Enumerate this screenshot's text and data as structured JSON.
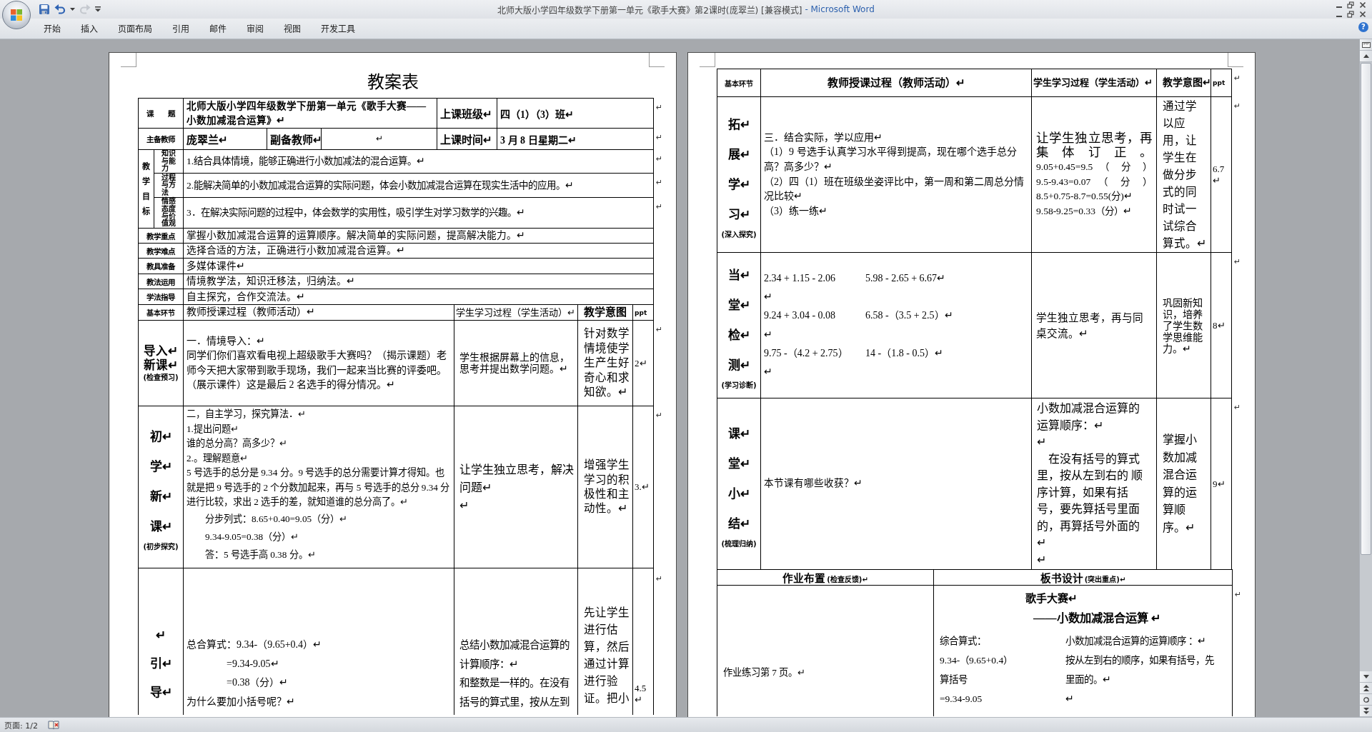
{
  "window": {
    "title": "北师大版小学四年级数学下册第一单元《歌手大赛》第2课时(庞翠兰) [兼容模式]",
    "app_name": "- Microsoft Word"
  },
  "quick_access": [
    {
      "kind": "save",
      "disabled": false
    },
    {
      "kind": "undo",
      "disabled": false
    },
    {
      "kind": "undo_menu",
      "disabled": false
    },
    {
      "kind": "redo",
      "disabled": true
    },
    {
      "kind": "customize",
      "disabled": false
    }
  ],
  "ribbon": {
    "tabs": [
      {
        "label": "开始",
        "selected": false
      },
      {
        "label": "插入",
        "selected": false
      },
      {
        "label": "页面布局",
        "selected": false
      },
      {
        "label": "引用",
        "selected": false
      },
      {
        "label": "邮件",
        "selected": false
      },
      {
        "label": "审阅",
        "selected": false
      },
      {
        "label": "视图",
        "selected": false
      },
      {
        "label": "开发工具",
        "selected": false
      }
    ],
    "help": "?"
  },
  "page_1": {
    "title": "教案表",
    "topic_row": {
      "label": "课　　题",
      "title": "北师大版小学四年级数学下册第一单元《歌手大赛——小数加减混合运算》↵",
      "class_label": "上课班级↵",
      "class_value": "四（1）（3）班↵",
      "end_mark": "↵"
    },
    "teacher_row": {
      "label": "主备教师",
      "lead_teacher": "庞翠兰↵",
      "assistant_label": "副备教师↵",
      "assistant": "↵",
      "time_label": "上课时间↵",
      "time": "3 月 8 日星期二↵",
      "end_mark": "↵"
    },
    "goals": {
      "label": "教学目标",
      "items": [
        {
          "label": "知识与能力",
          "text": "1.结合具体情境，能够正确进行小数加减法的混合运算。↵",
          "end_mark": "↵"
        },
        {
          "label": "过程与方法",
          "text": "2.能解决简单的小数加减混合运算的实际问题，体会小数加减混合运算在现实生活中的应用。↵",
          "end_mark": "↵"
        },
        {
          "label": "情感态度与价值观",
          "text": "3．在解决实际问题的过程中，体会数学的实用性，吸引学生对学习数学的兴趣。↵",
          "end_mark": "↵"
        }
      ]
    },
    "plan_rows": [
      {
        "label": "教学重点",
        "text": "掌握小数加减混合运算的运算顺序。解决简单的实际问题，提高解决能力。↵"
      },
      {
        "label": "教学难点",
        "text": "选择合适的方法，正确进行小数加减混合运算。↵"
      },
      {
        "label": "教具准备",
        "text": "多媒体课件↵"
      },
      {
        "label": "教法运用",
        "text": "情境教学法，知识迁移法，归纳法。↵"
      },
      {
        "label": "学法指导",
        "text": "自主探究，合作交流法。↵"
      }
    ],
    "lesson": {
      "header": [
        "基本环节",
        "教师授课过程（教师活动）↵",
        "学生学习过程（学生活动）↵",
        "教学意图",
        "ppt"
      ],
      "rows": [
        {
          "stage": [
            "导入↵",
            "新课↵"
          ],
          "stage_note": "(检查预习)",
          "teacher": [
            "一．情境导入：↵",
            "同学们你们喜欢看电视上超级歌手大赛吗？（揭示课题）老师今天把大家带到歌手现场，我们一起来当比赛的评委吧。（展示课件）这是最后 2 名选手的得分情况。↵"
          ],
          "student": [
            "学生根据屏幕上的信息，思考并提出数学问题。↵"
          ],
          "intent": [
            "针对数学情境使学生产生好奇心和求知欲。↵"
          ],
          "ppt": "2↵",
          "end_mark": "↵"
        },
        {
          "stage": [
            "初↵",
            "学↵",
            "新↵",
            "课↵"
          ],
          "stage_note": "(初步探究)",
          "teacher": [
            "二，自主学习，探究算法．↵",
            "1.提出问题↵",
            "谁的总分高？高多少？↵",
            "2.。理解题意↵",
            "5 号选手的总分是 9.34 分。9 号选手的总分需要计算才得知。也就是把 9 号选手的 2 个分数加起来，再与 5 号选手的总分 9.34 分进行比较，求出 2 选手的差，就知道谁的总分高了。↵",
            "　　分步列式：8.65+0.40=9.05（分）↵",
            "　　9.34-9.05=0.38（分）↵",
            "　　答：5 号选手高 0.38 分。↵"
          ],
          "student": [
            "让学生独立思考，解决问题↵",
            "↵"
          ],
          "intent": [
            "增强学生学习的积极性和主动性。↵"
          ],
          "ppt": "3.↵",
          "end_mark": "↵"
        },
        {
          "stage": [
            "↵",
            "引↵",
            "导↵"
          ],
          "teacher": [
            "总合算式：9.34-（9.65+0.4）↵",
            "　　　　=9.34-9.05↵",
            "　　　　=0.38（分）↵",
            "为什么要加小括号呢？↵"
          ],
          "student": [
            "总结小数加减混合运算的计算顺序：↵",
            "和整数是一样的。在没有括号的算式里，按从左到"
          ],
          "intent": [
            "先让学生进行估算，然后通过计算进行验证。把小"
          ],
          "ppt": "4.5↵",
          "end_mark": "↵"
        }
      ]
    }
  },
  "page_2": {
    "lesson": {
      "header": [
        "基本环节",
        "教师授课过程（教师活动）↵",
        "学生学习过程（学生活动）↵",
        "教学意图↵",
        "ppt"
      ],
      "header_end_mark": "↵",
      "rows": [
        {
          "stage": [
            "拓↵",
            "展↵",
            "学↵",
            "习↵"
          ],
          "stage_note": "(深入探究)",
          "teacher": [
            "三．结合实际，学以应用↵",
            "（1）9 号选手认真学习水平得到提高，现在哪个选手总分高？高多少？↵",
            "（2）四（1）班在班级坐姿评比中，第一周和第二周总分情况比较↵",
            "（3）练一练↵"
          ],
          "student": [
            "让学生独立思考，再集体订正。",
            "9.05+0.45=9.5 （ 分 ）",
            "9.5-9.43=0.07 （ 分 ）",
            "8.5+0.75-8.7=0.55(分)↵",
            "9.58-9.25=0.33（分）↵"
          ],
          "intent": [
            "通过学以应用，让学生在做分步式的同时试一试综合算式。↵"
          ],
          "ppt": "6.7↵",
          "end_mark": "↵"
        },
        {
          "stage": [
            "当↵",
            "堂↵",
            "检↵",
            "测↵"
          ],
          "stage_note": "(学习诊断)",
          "teacher": [
            "2.34 + 1.15 - 2.06　　　5.98 - 2.65 + 6.67↵",
            "↵",
            "9.24 + 3.04 - 0.08　　　6.58 -（3.5 + 2.5）↵",
            "↵",
            "9.75 -（4.2 + 2.75）　　 14 -（1.8 - 0.5）↵",
            "↵"
          ],
          "student": [
            "学生独立思考，再与同桌交流。↵"
          ],
          "intent": [
            "巩固新知识，培养了学生数学思维能力。↵"
          ],
          "ppt": "8↵",
          "end_mark": "↵"
        },
        {
          "stage": [
            "课↵",
            "堂↵",
            "小↵",
            "结↵"
          ],
          "stage_note": "(梳理归纳)",
          "teacher": [
            "本节课有哪些收获？↵"
          ],
          "student": [
            "小数加减混合运算的运算顺序：↵",
            "↵",
            "　在没有括号的算式里，按从左到右的 顺序计算，如果有括号，要先算括号里面的，再算括号外面的↵",
            "↵"
          ],
          "intent": [
            "掌握小数加减混合运算的运算顺序。↵"
          ],
          "ppt": "9↵",
          "end_mark": "↵"
        }
      ]
    },
    "homework": {
      "headers": [
        {
          "title": "作业布置",
          "note": "(检查反馈)↵"
        },
        {
          "title": "板书设计",
          "note": "(突出重点)↵"
        }
      ],
      "assignment": "作业练习第 7 页。↵",
      "board": {
        "title": "歌手大赛↵",
        "subtitle": "——小数加减混合运算 ↵",
        "left": [
          "综合算式：",
          "9.34-（9.65+0.4）",
          "算括号",
          "=9.34-9.05"
        ],
        "right": [
          "小数加减混合运算的运算顺序 ：↵",
          "按从左到右的顺序，如果有括号，先",
          "里面的。↵",
          "↵"
        ]
      },
      "end_mark": "↵"
    }
  },
  "status_bar": {
    "page": "页面: 1/2"
  }
}
